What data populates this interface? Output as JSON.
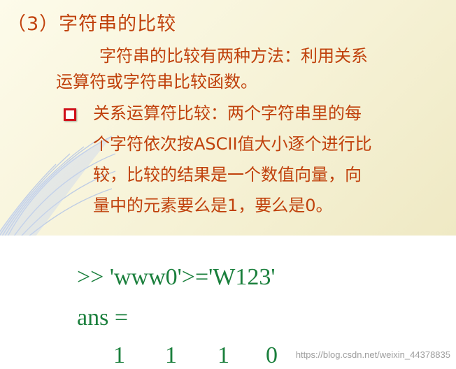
{
  "slide": {
    "title": "（3）字符串的比较",
    "intro_line1": "字符串的比较有两种方法：利用关系",
    "intro_line2": "运算符或字符串比较函数。",
    "bullet_lines": [
      "关系运算符比较：两个字符串里的每",
      "个字符依次按ASCII值大小逐个进行比",
      "较，比较的结果是一个数值向量，向",
      "量中的元素要么是1，要么是0。"
    ]
  },
  "code": {
    "command": ">> 'www0'>='W123'",
    "ans_label": "ans =",
    "values": [
      "1",
      "1",
      "1",
      "0"
    ]
  },
  "watermark": "https://blog.csdn.net/weixin_44378835",
  "colors": {
    "text_orange": "#c0410c",
    "bullet_red": "#d0101a",
    "code_green": "#1a7f3c"
  }
}
